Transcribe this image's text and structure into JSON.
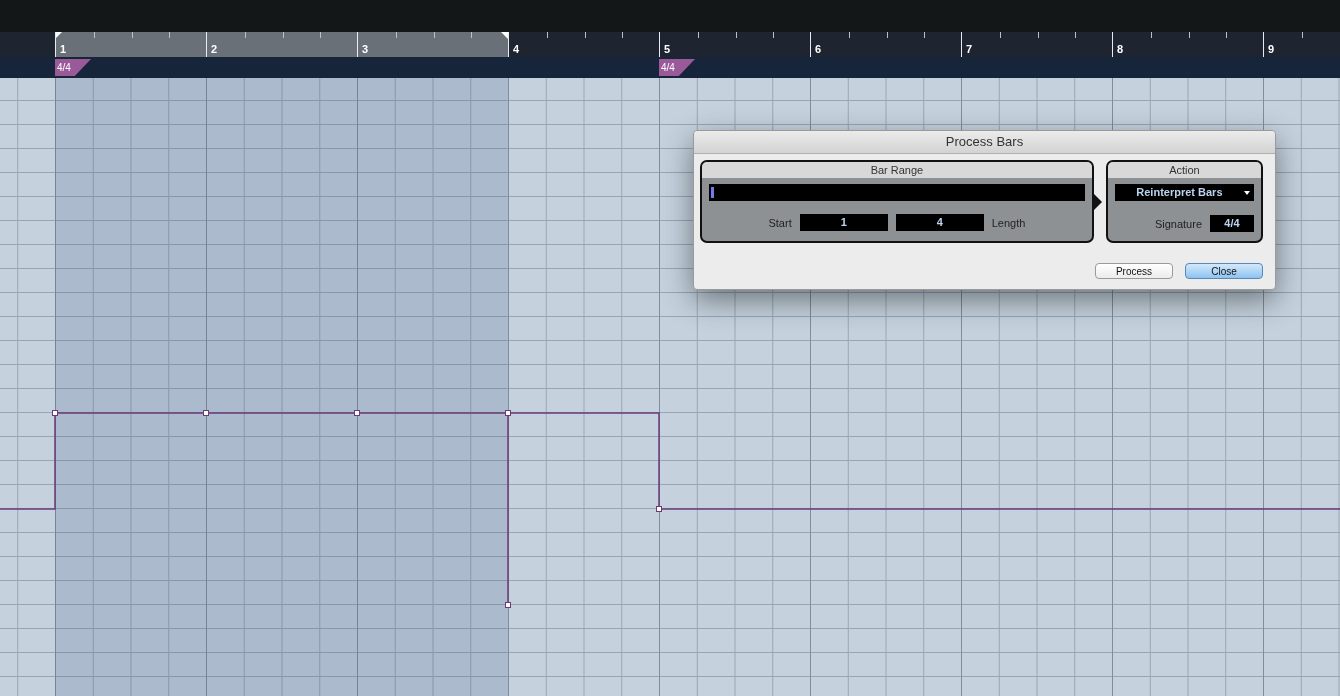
{
  "ruler": {
    "bars": [
      {
        "label": "1",
        "selected": true,
        "signature": "4/4"
      },
      {
        "label": "2",
        "selected": true
      },
      {
        "label": "3",
        "selected": true
      },
      {
        "label": "4",
        "selected": false
      },
      {
        "label": "5",
        "selected": false,
        "signature": "4/4"
      },
      {
        "label": "6",
        "selected": false
      },
      {
        "label": "7",
        "selected": false
      },
      {
        "label": "8",
        "selected": false
      },
      {
        "label": "9",
        "selected": false
      }
    ]
  },
  "dialog": {
    "title": "Process Bars",
    "bar_range": {
      "title": "Bar Range",
      "start_label": "Start",
      "start": "1",
      "length": "4",
      "length_label": "Length"
    },
    "action": {
      "title": "Action",
      "value": "Reinterpret Bars",
      "signature_label": "Signature",
      "signature": "4/4"
    },
    "buttons": [
      {
        "label": "Process",
        "default": false
      },
      {
        "label": "Close",
        "default": true
      }
    ]
  }
}
